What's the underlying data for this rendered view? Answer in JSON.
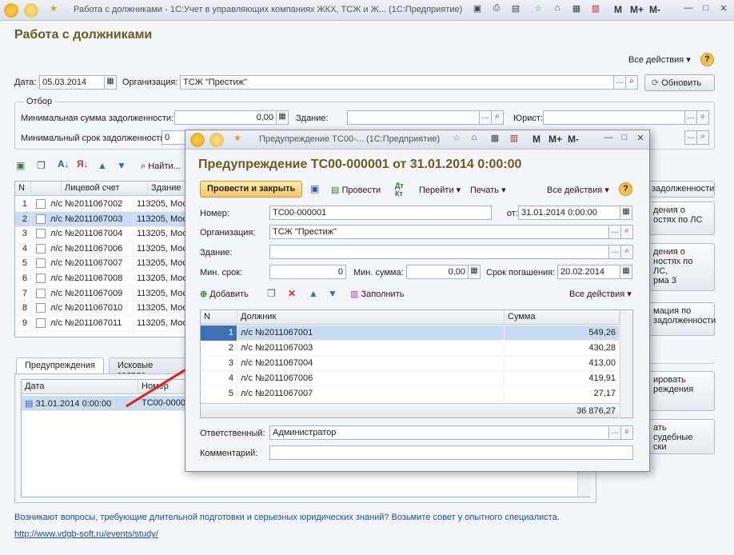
{
  "window": {
    "title": "Работа с должниками - 1С:Учет в управляющих компаниях ЖКХ, ТСЖ и Ж...  (1С:Предприятие)",
    "m_buttons": [
      "M",
      "M+",
      "M-"
    ]
  },
  "page": {
    "title": "Работа с должниками",
    "all_actions": "Все действия",
    "help": "?"
  },
  "filters": {
    "date_label": "Дата:",
    "date_value": "05.03.2014",
    "org_label": "Организация:",
    "org_value": "ТСЖ \"Престиж\"",
    "refresh_label": "Обновить",
    "group_title": "Отбор",
    "min_sum_label": "Минимальная сумма задолженности:",
    "min_sum_value": "0,00",
    "building_label": "Здание:",
    "lawyer_label": "Юрист:",
    "min_term_label": "Минимальный срок задолженности:",
    "min_term_value": "0"
  },
  "toolbar": {
    "find_label": "Найти..."
  },
  "debtors_table": {
    "columns": [
      "N",
      "Лицевой счет",
      "Здание"
    ],
    "rows": [
      {
        "n": "1",
        "account": "л/с №2011067002",
        "building": "113205, Мос"
      },
      {
        "n": "2",
        "account": "л/с №2011067003",
        "building": "113205, Мос"
      },
      {
        "n": "3",
        "account": "л/с №2011067004",
        "building": "113205, Мос"
      },
      {
        "n": "4",
        "account": "л/с №2011067006",
        "building": "113205, Мос"
      },
      {
        "n": "5",
        "account": "л/с №2011067007",
        "building": "113205, Мос"
      },
      {
        "n": "6",
        "account": "л/с №2011067008",
        "building": "113205, Мос"
      },
      {
        "n": "7",
        "account": "л/с №2011067009",
        "building": "113205, Мос"
      },
      {
        "n": "8",
        "account": "л/с №2011067010",
        "building": "113205, Мос"
      },
      {
        "n": "9",
        "account": "л/с №2011067011",
        "building": "113205, Мос"
      }
    ]
  },
  "side_buttons": {
    "debts": "задолженности",
    "b1_line1": "дения о",
    "b1_line2": "остях по ЛС",
    "b2_line1": "дения о",
    "b2_line2": "ностях по ЛС,",
    "b2_line3": "рма 3",
    "b3_line1": "мация по",
    "b3_line2": "задолженности",
    "b4_line1": "ировать",
    "b4_line2": "реждения",
    "b5_line1": "ать судебные",
    "b5_line2": "ски"
  },
  "tabs": [
    "Предупреждения",
    "Исковые заявле"
  ],
  "warnings_table": {
    "columns": [
      "Дата",
      "Номер"
    ],
    "rows": [
      {
        "date": "31.01.2014 0:00:00",
        "number": "ТС00-00000"
      }
    ]
  },
  "footer": {
    "advice": "Возникают вопросы, требующие длительной подготовки и серьезных юридических знаний? Возьмите совет у опытного специалиста.",
    "link": "http://www.vdgb-soft.ru/events/study/"
  },
  "dialog": {
    "window_title": "Предупреждение ТС00-...  (1С:Предприятие)",
    "title": "Предупреждение ТС00-000001 от 31.01.2014 0:00:00",
    "post_close": "Провести и закрыть",
    "post": "Провести",
    "goto": "Перейти",
    "print": "Печать",
    "all_actions": "Все действия",
    "number_label": "Номер:",
    "number_value": "ТС00-000001",
    "from_label": "от:",
    "from_value": "31.01.2014  0:00:00",
    "org_label": "Организация:",
    "org_value": "ТСЖ \"Престиж\"",
    "building_label": "Здание:",
    "min_term_label": "Мин. срок:",
    "min_term_value": "0",
    "min_sum_label": "Мин. сумма:",
    "min_sum_value": "0,00",
    "due_label": "Срок погашения:",
    "due_value": "20.02.2014",
    "add_label": "Добавить",
    "fill_label": "Заполнить",
    "table_columns": [
      "N",
      "Должник",
      "Сумма"
    ],
    "table_rows": [
      {
        "n": "1",
        "debtor": "л/с №2011067001",
        "sum": "549,26"
      },
      {
        "n": "2",
        "debtor": "л/с №2011067003",
        "sum": "430,28"
      },
      {
        "n": "3",
        "debtor": "л/с №2011067004",
        "sum": "413,00"
      },
      {
        "n": "4",
        "debtor": "л/с №2011067006",
        "sum": "419,91"
      },
      {
        "n": "5",
        "debtor": "л/с №2011067007",
        "sum": "27,17"
      }
    ],
    "total": "36 876,27",
    "responsible_label": "Ответственный:",
    "responsible_value": "Администратор",
    "comment_label": "Комментарий:"
  },
  "colors": {
    "title": "#6b5b1f",
    "accent": "#f3c76a",
    "arrow": "#e0201b",
    "link": "#1a4fa0"
  }
}
